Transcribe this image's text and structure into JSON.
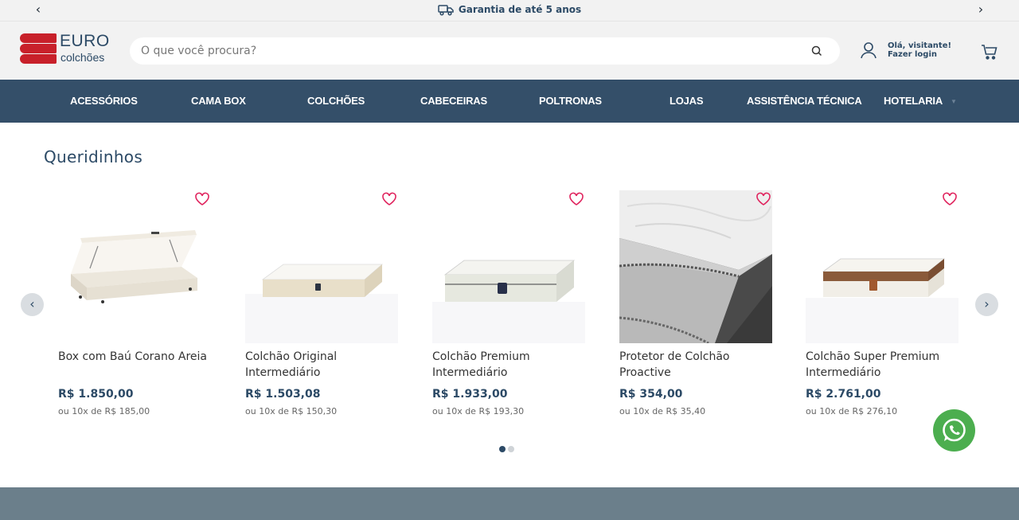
{
  "topbar": {
    "prev_icon": "chevron-left-icon",
    "next_icon": "chevron-right-icon",
    "promo_icon": "truck-icon",
    "promo_text": "Garantia de até 5 anos"
  },
  "header": {
    "logo_text": "EURO",
    "logo_subtext": "colchões",
    "search_placeholder": "O que você procura?",
    "search_value": "",
    "account_text": "Olá, visitante! Fazer login"
  },
  "nav": {
    "items": [
      "ACESSÓRIOS",
      "CAMA BOX",
      "COLCHÕES",
      "CABECEIRAS",
      "POLTRONAS",
      "LOJAS",
      "ASSISTÊNCIA TÉCNICA",
      "HOTELARIA"
    ]
  },
  "section": {
    "title": "Queridinhos"
  },
  "products": [
    {
      "name": "Box com Baú Corano Areia",
      "price": "R$ 1.850,00",
      "installments": "ou 10x de R$ 185,00"
    },
    {
      "name": "Colchão Original Intermediário",
      "price": "R$ 1.503,08",
      "installments": "ou 10x de R$ 150,30"
    },
    {
      "name": "Colchão Premium Intermediário",
      "price": "R$ 1.933,00",
      "installments": "ou 10x de R$ 193,30"
    },
    {
      "name": "Protetor de Colchão Proactive",
      "price": "R$ 354,00",
      "installments": "ou 10x de R$ 35,40"
    },
    {
      "name": "Colchão Super Premium Intermediário",
      "price": "R$ 2.761,00",
      "installments": "ou 10x de R$ 276,10"
    }
  ],
  "carousel": {
    "pages": 2,
    "active_page": 1
  },
  "colors": {
    "brand_blue": "#2c4a66",
    "nav_bg": "#344f69",
    "brand_red": "#c8202a",
    "favorite_pink": "#e0245e",
    "whatsapp_green": "#4cae4f"
  }
}
